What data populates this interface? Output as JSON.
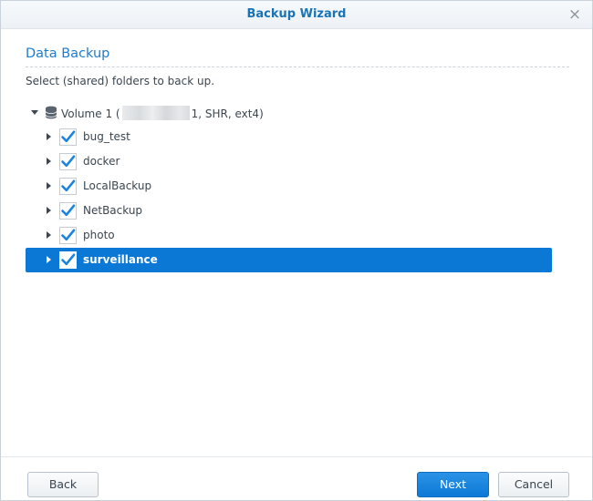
{
  "window": {
    "title": "Backup Wizard",
    "close_icon": "×"
  },
  "section": {
    "title": "Data Backup",
    "description": "Select (shared) folders to back up."
  },
  "tree": {
    "volume": {
      "label_prefix": "Volume 1 (",
      "label_suffix": "1, SHR, ext4)",
      "expanded": true,
      "icon": "database-icon"
    },
    "folders": [
      {
        "label": "bug_test",
        "checked": true,
        "selected": false
      },
      {
        "label": "docker",
        "checked": true,
        "selected": false
      },
      {
        "label": "LocalBackup",
        "checked": true,
        "selected": false
      },
      {
        "label": "NetBackup",
        "checked": true,
        "selected": false
      },
      {
        "label": "photo",
        "checked": true,
        "selected": false
      },
      {
        "label": "surveillance",
        "checked": true,
        "selected": true
      }
    ]
  },
  "footer": {
    "back_label": "Back",
    "next_label": "Next",
    "cancel_label": "Cancel"
  },
  "colors": {
    "accent": "#0c78d6",
    "title": "#1a73b5",
    "check": "#1a84e0"
  }
}
